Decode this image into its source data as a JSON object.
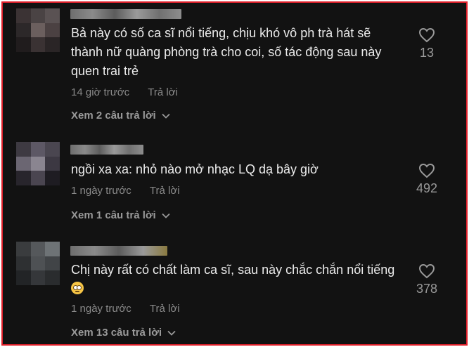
{
  "comments": [
    {
      "text": "Bả này có số ca sĩ nổi tiếng, chịu khó vô ph trà hát sẽ thành nữ quàng phòng trà cho coi, số tác động sau này quen trai trẻ",
      "time": "14 giờ trước",
      "reply_label": "Trả lời",
      "view_replies": "Xem 2 câu trả lời",
      "likes": "13"
    },
    {
      "text": "ngồi xa xa: nhỏ nào mở nhạc LQ dạ bây giờ",
      "time": "1 ngày trước",
      "reply_label": "Trả lời",
      "view_replies": "Xem 1 câu trả lời",
      "likes": "492"
    },
    {
      "text": "Chị này rất có chất làm ca sĩ, sau này chắc chắn nổi tiếng",
      "emoji": "eye-roll-emoji",
      "time": "1 ngày trước",
      "reply_label": "Trả lời",
      "view_replies": "Xem 13 câu trả lời",
      "likes": "378"
    }
  ],
  "colors": {
    "border": "#e0202a",
    "background": "#121212",
    "text": "#ececec",
    "muted": "#8a8a8a"
  },
  "icons": [
    "heart-icon",
    "chevron-down-icon"
  ]
}
